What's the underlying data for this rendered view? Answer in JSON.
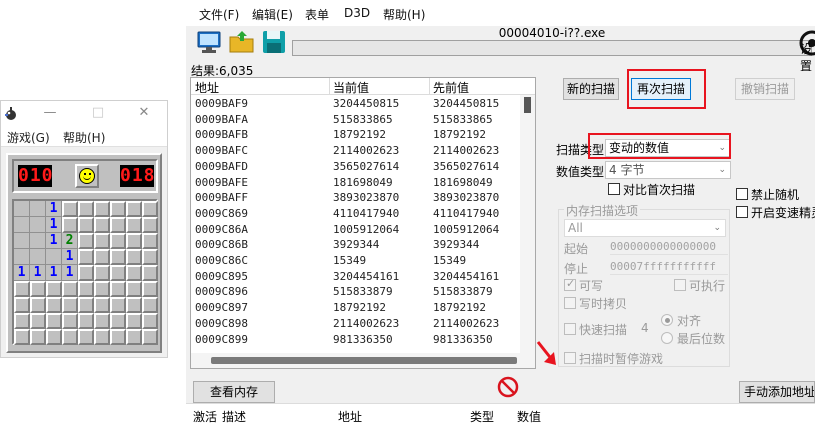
{
  "minesweeper": {
    "menu": [
      "游戏(G)",
      "帮助(H)"
    ],
    "controls": {
      "minimize": "—",
      "maximize": "□",
      "close": "✕"
    },
    "mine_counter": "010",
    "timer": "018",
    "grid": [
      [
        "o",
        "o",
        "1",
        "c",
        "c",
        "c",
        "c",
        "c",
        "c"
      ],
      [
        "o",
        "o",
        "1",
        "c",
        "c",
        "c",
        "c",
        "c",
        "c"
      ],
      [
        "o",
        "o",
        "1",
        "2",
        "c",
        "c",
        "c",
        "c",
        "c"
      ],
      [
        "o",
        "o",
        "o",
        "1",
        "c",
        "c",
        "c",
        "c",
        "c"
      ],
      [
        "1",
        "1",
        "1",
        "1",
        "c",
        "c",
        "c",
        "c",
        "c"
      ],
      [
        "c",
        "c",
        "c",
        "c",
        "c",
        "c",
        "c",
        "c",
        "c"
      ],
      [
        "c",
        "c",
        "c",
        "c",
        "c",
        "c",
        "c",
        "c",
        "c"
      ],
      [
        "c",
        "c",
        "c",
        "c",
        "c",
        "c",
        "c",
        "c",
        "c"
      ],
      [
        "c",
        "c",
        "c",
        "c",
        "c",
        "c",
        "c",
        "c",
        "c"
      ]
    ],
    "number_colors": {
      "1": "#0000ff",
      "2": "#008000"
    }
  },
  "cheat_engine": {
    "menu": [
      "文件(F)",
      "编辑(E)",
      "表单",
      "D3D",
      "帮助(H)"
    ],
    "process_title": "00004010-i??.exe",
    "settings_label": "设置",
    "result_count": "结果:6,035",
    "columns": [
      "地址",
      "当前值",
      "先前值"
    ],
    "rows": [
      [
        "0009BAF9",
        "3204450815",
        "3204450815"
      ],
      [
        "0009BAFA",
        "515833865",
        "515833865"
      ],
      [
        "0009BAFB",
        "18792192",
        "18792192"
      ],
      [
        "0009BAFC",
        "2114002623",
        "2114002623"
      ],
      [
        "0009BAFD",
        "3565027614",
        "3565027614"
      ],
      [
        "0009BAFE",
        "181698049",
        "181698049"
      ],
      [
        "0009BAFF",
        "3893023870",
        "3893023870"
      ],
      [
        "0009C869",
        "4110417940",
        "4110417940"
      ],
      [
        "0009C86A",
        "1005912064",
        "1005912064"
      ],
      [
        "0009C86B",
        "3929344",
        "3929344"
      ],
      [
        "0009C86C",
        "15349",
        "15349"
      ],
      [
        "0009C895",
        "3204454161",
        "3204454161"
      ],
      [
        "0009C896",
        "515833879",
        "515833879"
      ],
      [
        "0009C897",
        "18792192",
        "18792192"
      ],
      [
        "0009C898",
        "2114002623",
        "2114002623"
      ],
      [
        "0009C899",
        "981336350",
        "981336350"
      ]
    ],
    "buttons": {
      "new_scan": "新的扫描",
      "next_scan": "再次扫描",
      "undo_scan": "撤销扫描",
      "view_memory": "查看内存",
      "add_address": "手动添加地址"
    },
    "scan_type_label": "扫描类型",
    "scan_type_value": "变动的数值",
    "value_type_label": "数值类型",
    "value_type_value": "4 字节",
    "compare_first": "对比首次扫描",
    "disable_random": "禁止随机",
    "enable_speedhack": "开启变速精灵",
    "mem_options_title": "内存扫描选项",
    "mem_region": "All",
    "start_label": "起始",
    "start_value": "0000000000000000",
    "stop_label": "停止",
    "stop_value": "00007fffffffffff",
    "writable": "可写",
    "executable": "可执行",
    "copy_on_write": "写时拷贝",
    "fast_scan": "快速扫描",
    "fast_scan_value": "4",
    "align": "对齐",
    "last_digits": "最后位数",
    "pause_game": "扫描时暂停游戏",
    "bottom_columns": [
      "激活",
      "描述",
      "地址",
      "类型",
      "数值"
    ],
    "highlight_color": "#e8141f"
  }
}
